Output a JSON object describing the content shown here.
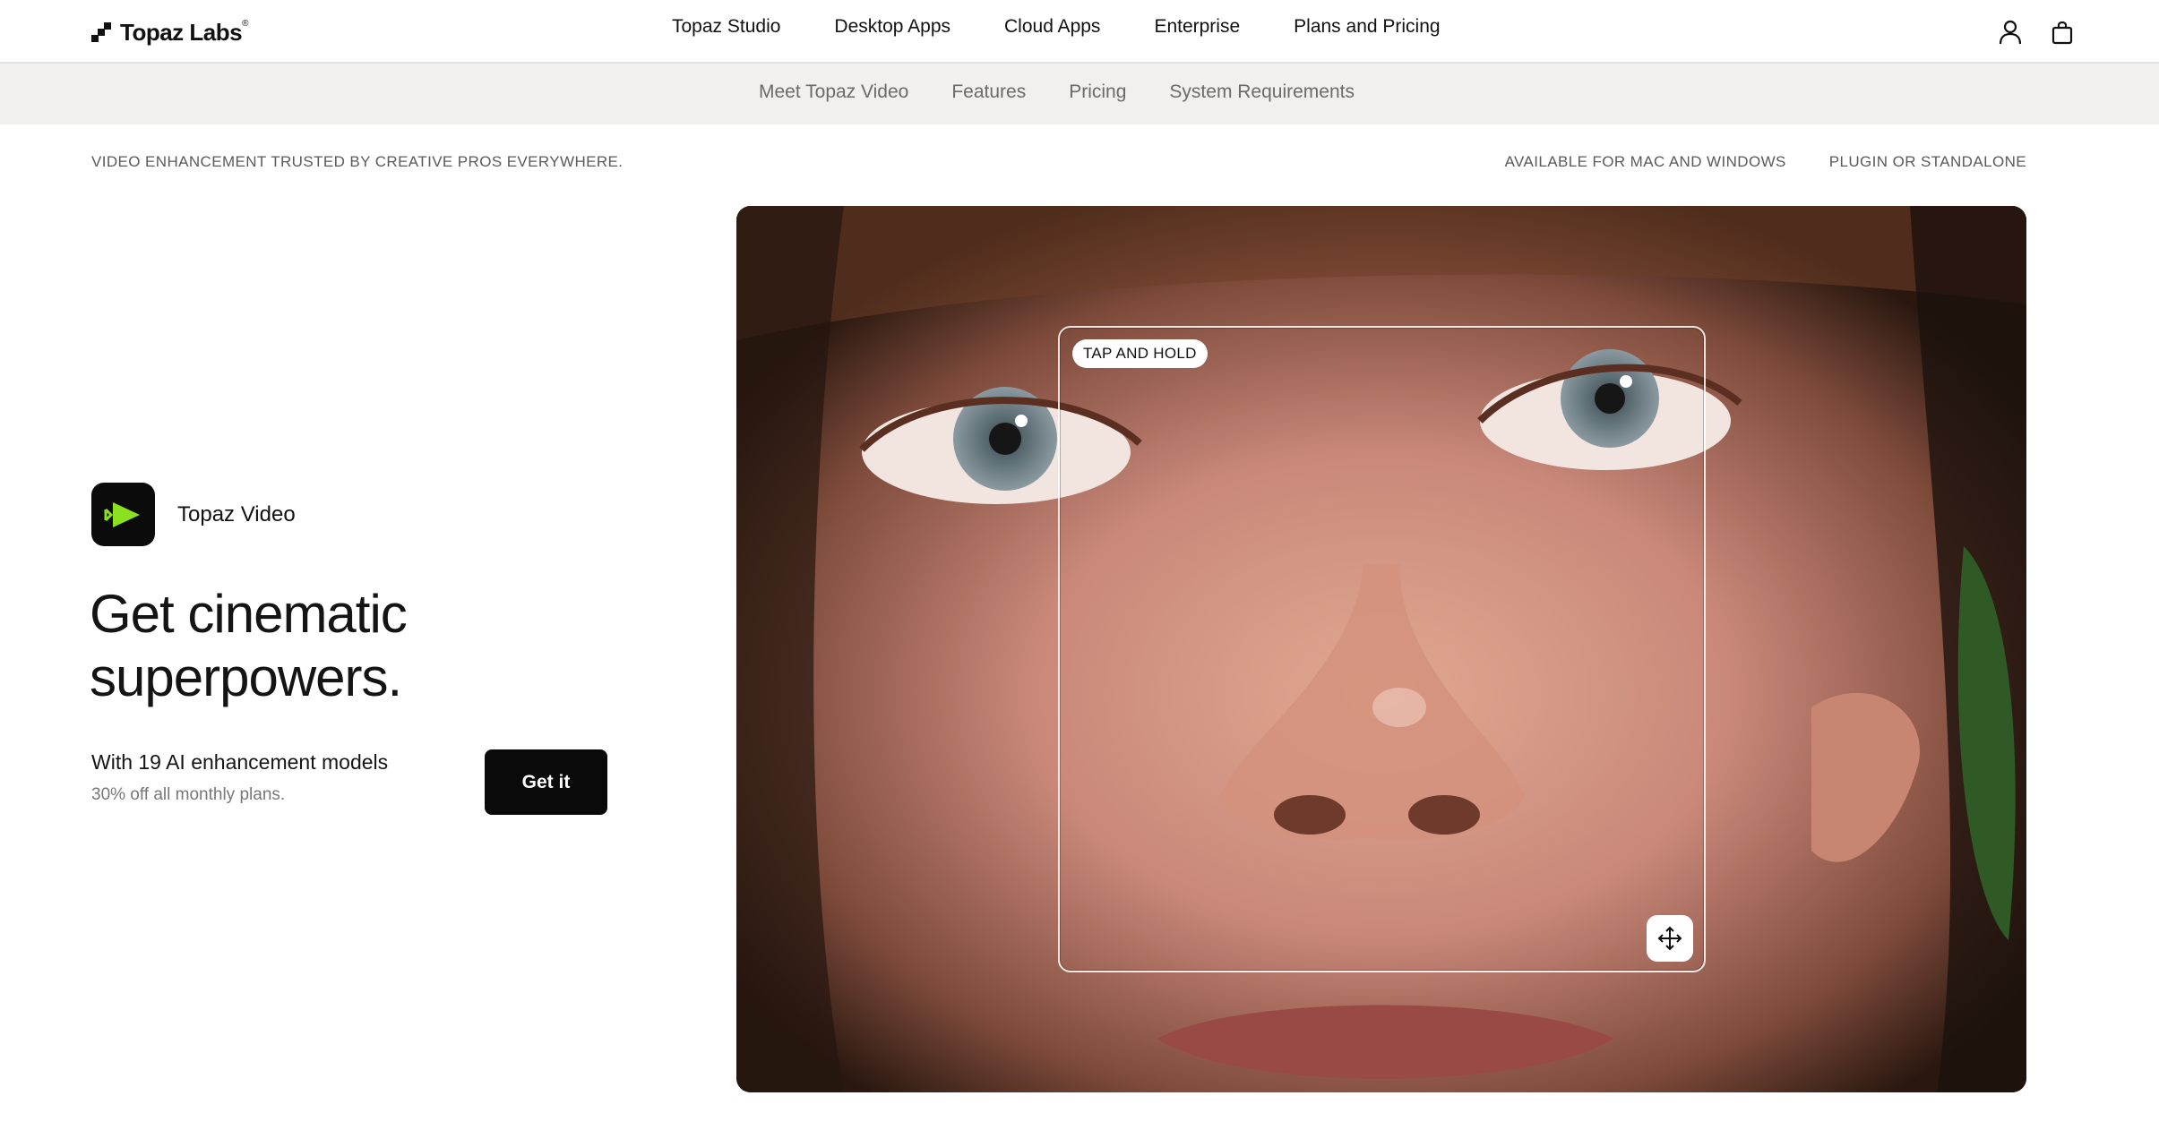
{
  "brand": {
    "name": "Topaz Labs",
    "mark": "®"
  },
  "nav": {
    "items": [
      "Topaz Studio",
      "Desktop Apps",
      "Cloud Apps",
      "Enterprise",
      "Plans and Pricing"
    ],
    "icons": [
      "account-icon",
      "cart-icon"
    ]
  },
  "subnav": {
    "items": [
      "Meet Topaz Video",
      "Features",
      "Pricing",
      "System Requirements"
    ]
  },
  "trust": {
    "left": "VIDEO ENHANCEMENT TRUSTED BY CREATIVE PROS EVERYWHERE.",
    "right": [
      "AVAILABLE FOR MAC AND WINDOWS",
      "PLUGIN OR STANDALONE"
    ]
  },
  "hero": {
    "product_name": "Topaz Video",
    "headline": "Get cinematic superpowers.",
    "models_text": "With 19 AI enhancement models",
    "discount_text": "30% off all monthly plans.",
    "cta_label": "Get it",
    "compare_badge": "TAP AND HOLD"
  },
  "colors": {
    "accent_green": "#8be01f",
    "cta_bg": "#0a0a0a",
    "subnav_bg": "#f1f0ee"
  }
}
